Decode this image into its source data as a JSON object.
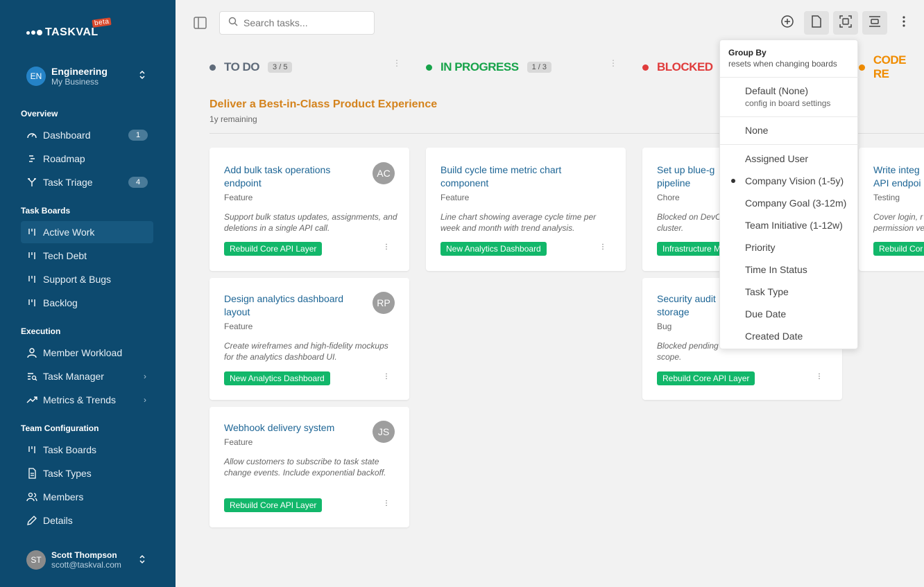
{
  "app": {
    "logo": "TASKVAL",
    "beta": "beta"
  },
  "org": {
    "initials": "EN",
    "name": "Engineering",
    "sub": "My Business"
  },
  "sidebar": {
    "sections": [
      {
        "title": "Overview"
      },
      {
        "title": "Task Boards"
      },
      {
        "title": "Execution"
      },
      {
        "title": "Team Configuration"
      }
    ],
    "items": [
      {
        "label": "Dashboard",
        "badge": "1"
      },
      {
        "label": "Roadmap"
      },
      {
        "label": "Task Triage",
        "badge": "4"
      },
      {
        "label": "Active Work"
      },
      {
        "label": "Tech Debt"
      },
      {
        "label": "Support & Bugs"
      },
      {
        "label": "Backlog"
      },
      {
        "label": "Member Workload"
      },
      {
        "label": "Task Manager"
      },
      {
        "label": "Metrics & Trends"
      },
      {
        "label": "Task Boards"
      },
      {
        "label": "Task Types"
      },
      {
        "label": "Members"
      },
      {
        "label": "Details"
      }
    ]
  },
  "user": {
    "initials": "ST",
    "name": "Scott Thompson",
    "email": "scott@taskval.com"
  },
  "search": {
    "placeholder": "Search tasks..."
  },
  "columns": [
    {
      "title": "TO DO",
      "count": "3 / 5",
      "color": "#5f6b7a"
    },
    {
      "title": "IN PROGRESS",
      "count": "1 / 3",
      "color": "#17a34a"
    },
    {
      "title": "BLOCKED",
      "color": "#e03c3c"
    },
    {
      "title": "CODE RE",
      "color": "#f08c00"
    }
  ],
  "group": {
    "title": "Deliver a Best-in-Class Product Experience",
    "sub": "1y remaining"
  },
  "cards": [
    {
      "title": "Add bulk task operations endpoint",
      "type": "Feature",
      "desc": "Support bulk status updates, assignments, and deletions in a single API call.",
      "tag": "Rebuild Core API Layer",
      "avatar": "AC"
    },
    {
      "title": "Design analytics dashboard layout",
      "type": "Feature",
      "desc": "Create wireframes and high-fidelity mockups for the analytics dashboard UI.",
      "tag": "New Analytics Dashboard",
      "avatar": "RP"
    },
    {
      "title": "Webhook delivery system",
      "type": "Feature",
      "desc": "Allow customers to subscribe to task state change events. Include exponential backoff.",
      "tag": "Rebuild Core API Layer",
      "avatar": "JS"
    },
    {
      "title": "Build cycle time metric chart component",
      "type": "Feature",
      "desc": "Line chart showing average cycle time per week and month with trend analysis.",
      "tag": "New Analytics Dashboard"
    },
    {
      "title": "Set up blue-g pipeline",
      "type": "Chore",
      "desc": "Blocked on DevC cluster.",
      "tag": "Infrastructure M"
    },
    {
      "title": "Security audit storage",
      "type": "Bug",
      "desc": "Blocked pending scope.",
      "tag": "Rebuild Core API Layer"
    },
    {
      "title": "Write integ API endpoi",
      "type": "Testing",
      "desc": "Cover login, r permission ve",
      "tag": "Rebuild Cor"
    }
  ],
  "dropdown": {
    "title": "Group By",
    "subtitle": "resets when changing boards",
    "default_label": "Default (None)",
    "default_sub": "config in board settings",
    "none": "None",
    "options": [
      "Assigned User",
      "Company Vision (1-5y)",
      "Company Goal (3-12m)",
      "Team Initiative (1-12w)",
      "Priority",
      "Time In Status",
      "Task Type",
      "Due Date",
      "Created Date"
    ],
    "selected": "Company Vision (1-5y)"
  }
}
